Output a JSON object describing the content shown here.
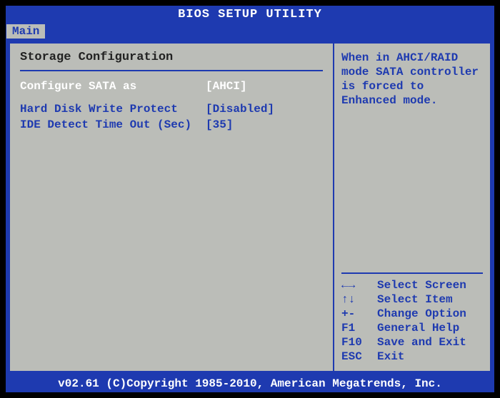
{
  "header": {
    "title": "BIOS SETUP UTILITY"
  },
  "tabs": [
    {
      "label": "Main"
    }
  ],
  "section": {
    "title": "Storage Configuration"
  },
  "settings": [
    {
      "label": "Configure SATA as",
      "value": "[AHCI]",
      "selected": true
    },
    {
      "label": "Hard Disk Write Protect",
      "value": "[Disabled]",
      "selected": false
    },
    {
      "label": "IDE Detect Time Out (Sec)",
      "value": "[35]",
      "selected": false
    }
  ],
  "help": {
    "text": "When in AHCI/RAID mode SATA controller is forced to Enhanced mode."
  },
  "keys": [
    {
      "key": "←→",
      "action": "Select Screen"
    },
    {
      "key": "↑↓",
      "action": "Select Item"
    },
    {
      "key": "+-",
      "action": "Change Option"
    },
    {
      "key": "F1",
      "action": "General Help"
    },
    {
      "key": "F10",
      "action": "Save and Exit"
    },
    {
      "key": "ESC",
      "action": "Exit"
    }
  ],
  "footer": {
    "text": "v02.61 (C)Copyright 1985-2010, American Megatrends, Inc."
  }
}
